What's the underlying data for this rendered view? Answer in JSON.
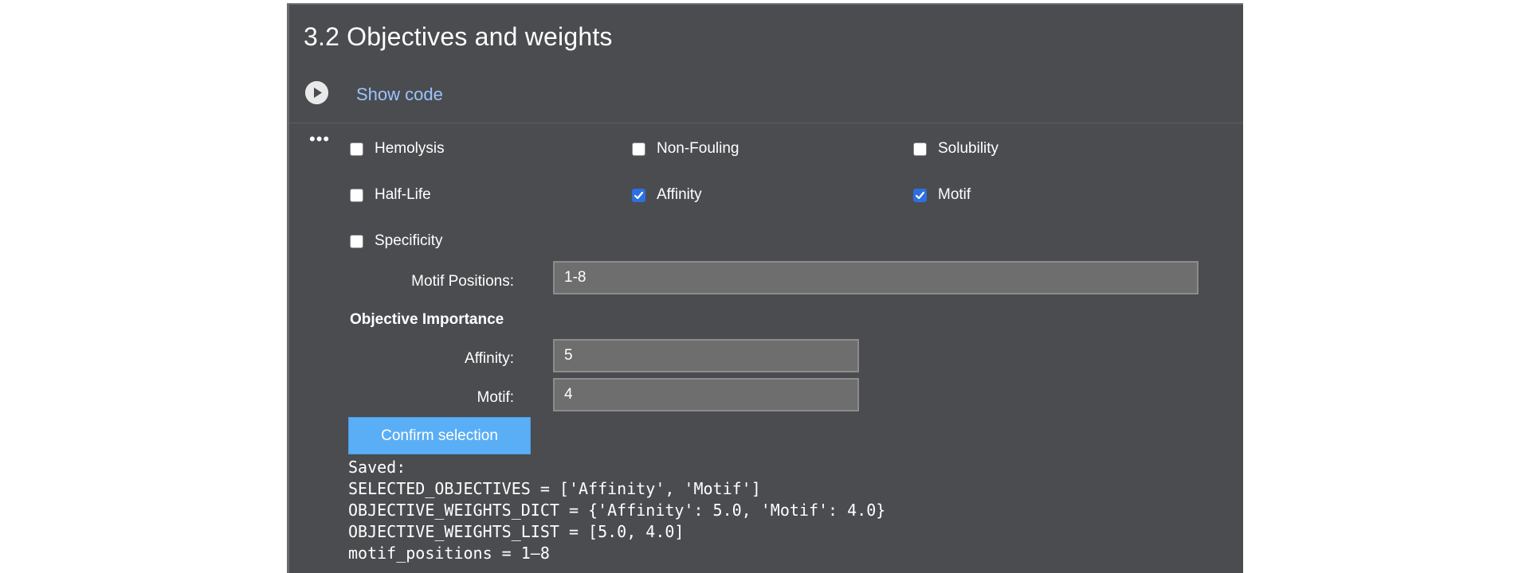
{
  "cell": {
    "title": "3.2 Objectives and weights",
    "show_code_label": "Show code",
    "more_label": "•••"
  },
  "objectives": [
    {
      "label": "Hemolysis",
      "checked": false
    },
    {
      "label": "Non-Fouling",
      "checked": false
    },
    {
      "label": "Solubility",
      "checked": false
    },
    {
      "label": "Half-Life",
      "checked": false
    },
    {
      "label": "Affinity",
      "checked": true
    },
    {
      "label": "Motif",
      "checked": true
    },
    {
      "label": "Specificity",
      "checked": false
    }
  ],
  "motif_positions": {
    "label": "Motif Positions:",
    "value": "1-8"
  },
  "importance": {
    "heading": "Objective Importance",
    "affinity_label": "Affinity:",
    "affinity_value": "5",
    "motif_label": "Motif:",
    "motif_value": "4"
  },
  "confirm_label": "Confirm selection",
  "output": {
    "lines": [
      "Saved:",
      "SELECTED_OBJECTIVES = ['Affinity', 'Motif']",
      "OBJECTIVE_WEIGHTS_DICT = {'Affinity': 5.0, 'Motif': 4.0}",
      "OBJECTIVE_WEIGHTS_LIST = [5.0, 4.0]",
      "motif_positions = 1–8"
    ]
  },
  "colors": {
    "panel_bg": "#4a4c4f",
    "link": "#9cc3ff",
    "button": "#5aaef5",
    "checkbox_checked": "#2d6fe0"
  },
  "icons": {
    "run": "play-circle-icon",
    "check": "checkmark-icon"
  }
}
